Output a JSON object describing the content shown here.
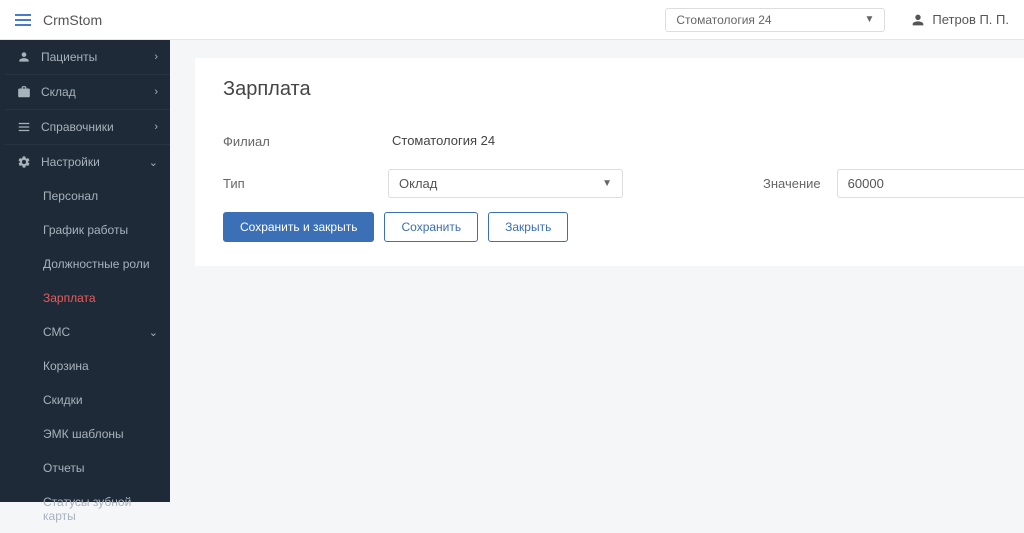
{
  "header": {
    "brand": "CrmStom",
    "org": "Стоматология 24",
    "user": "Петров П. П."
  },
  "sidebar": {
    "patients": "Пациенты",
    "warehouse": "Склад",
    "references": "Справочники",
    "settings": "Настройки",
    "sub": {
      "staff": "Персонал",
      "schedule": "График работы",
      "roles": "Должностные роли",
      "salary": "Зарплата",
      "sms": "СМС",
      "trash": "Корзина",
      "discounts": "Скидки",
      "emc": "ЭМК шаблоны",
      "reports": "Отчеты",
      "dental_statuses": "Статусы зубной карты"
    }
  },
  "page": {
    "title": "Зарплата",
    "labels": {
      "branch": "Филиал",
      "type": "Тип",
      "value": "Значение"
    },
    "fields": {
      "branch": "Стоматология 24",
      "type": "Оклад",
      "value": "60000"
    },
    "buttons": {
      "save_close": "Сохранить и закрыть",
      "save": "Сохранить",
      "close": "Закрыть"
    }
  }
}
